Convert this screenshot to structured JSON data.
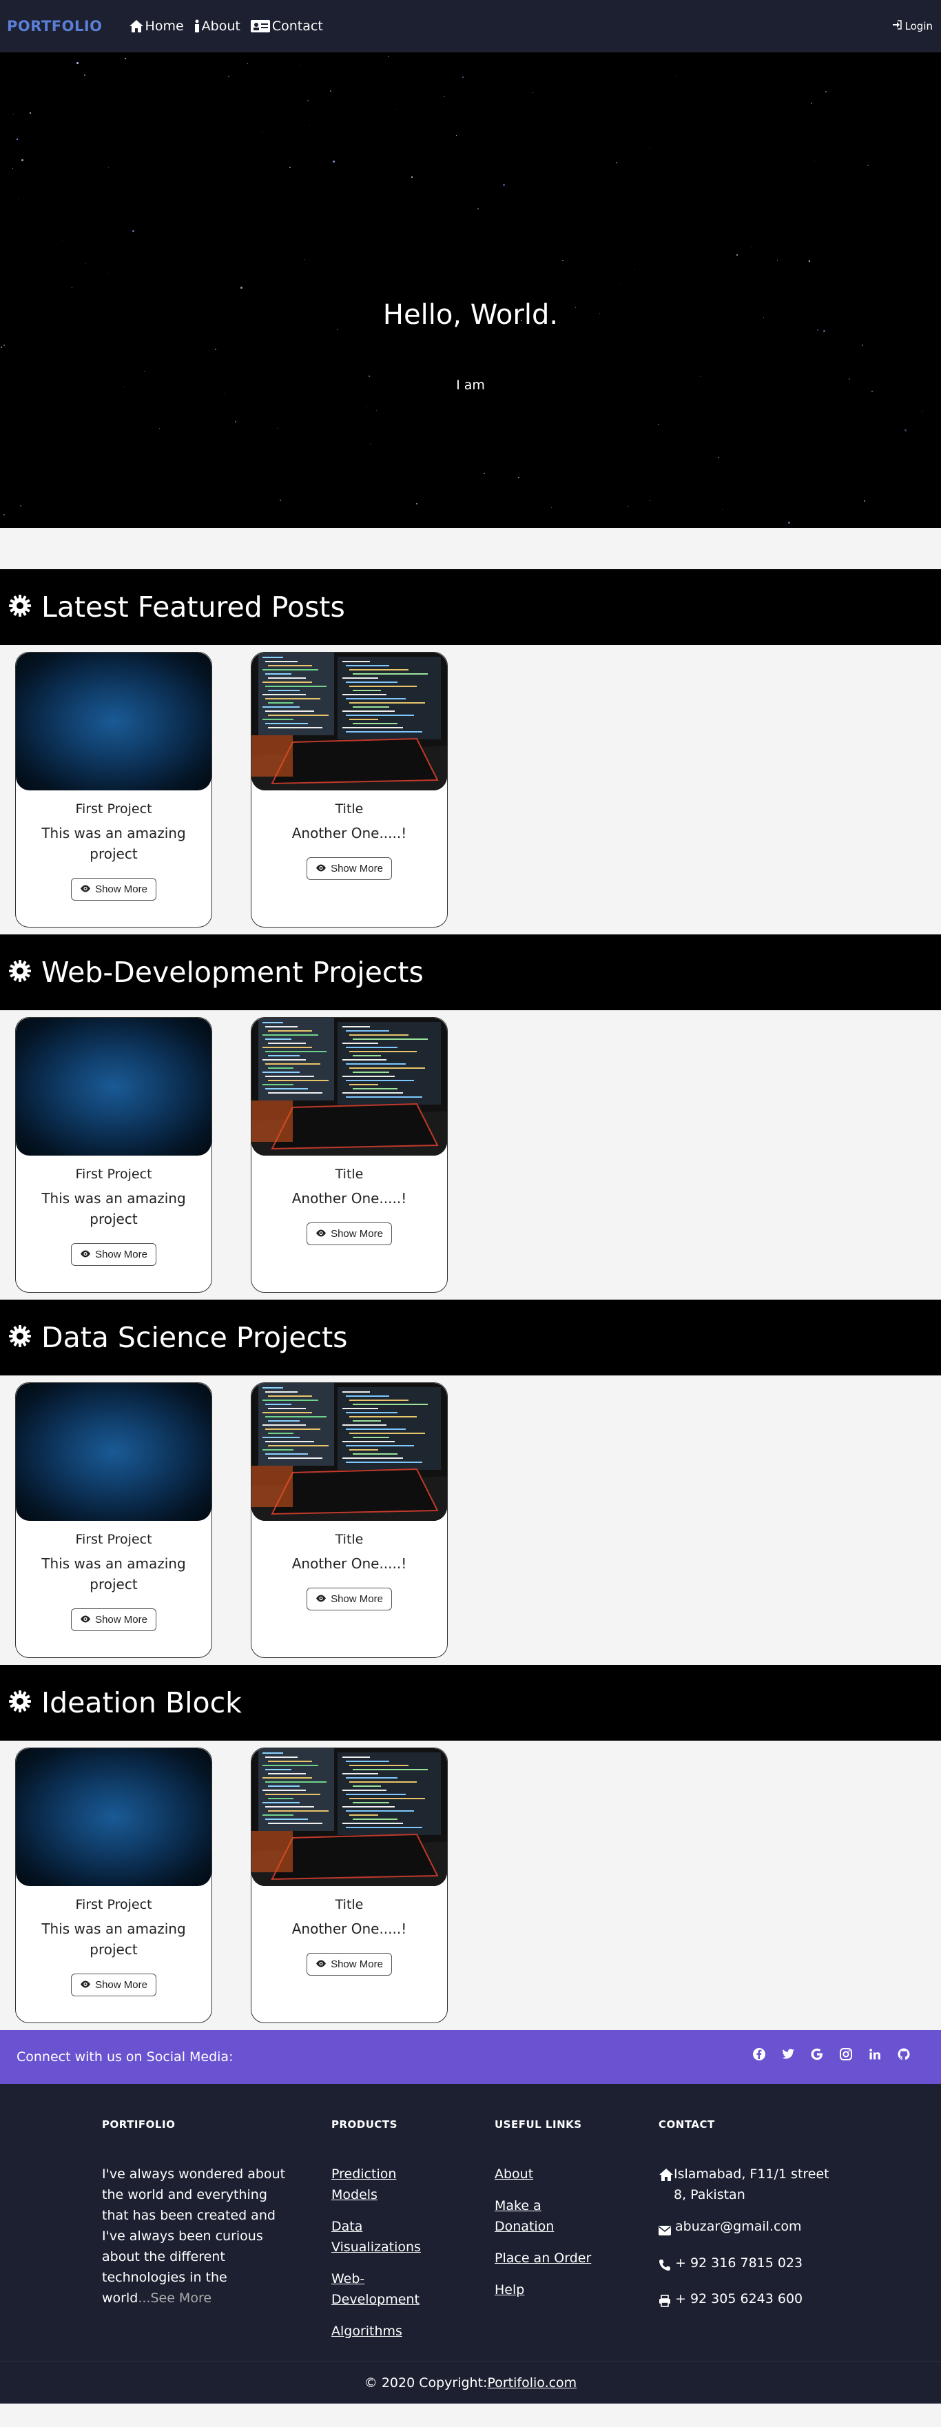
{
  "navbar": {
    "brand": "PORTFOLIO",
    "links": [
      {
        "label": "Home",
        "icon": "home-icon"
      },
      {
        "label": "About",
        "icon": "info-icon"
      },
      {
        "label": "Contact",
        "icon": "id-card-icon"
      }
    ],
    "login_label": "Login"
  },
  "hero": {
    "title": "Hello, World.",
    "subtitle": "I am"
  },
  "sections": [
    {
      "title": "Latest Featured Posts",
      "cards": [
        {
          "title": "First Project",
          "text": "This was an amazing project",
          "button": "Show More"
        },
        {
          "title": "Title",
          "text": "Another One.....!",
          "button": "Show More"
        }
      ]
    },
    {
      "title": "Web-Development Projects",
      "cards": [
        {
          "title": "First Project",
          "text": "This was an amazing project",
          "button": "Show More"
        },
        {
          "title": "Title",
          "text": "Another One.....!",
          "button": "Show More"
        }
      ]
    },
    {
      "title": "Data Science Projects",
      "cards": [
        {
          "title": "First Project",
          "text": "This was an amazing project",
          "button": "Show More"
        },
        {
          "title": "Title",
          "text": "Another One.....!",
          "button": "Show More"
        }
      ]
    },
    {
      "title": "Ideation Block",
      "cards": [
        {
          "title": "First Project",
          "text": "This was an amazing project",
          "button": "Show More"
        },
        {
          "title": "Title",
          "text": "Another One.....!",
          "button": "Show More"
        }
      ]
    }
  ],
  "social": {
    "text": "Connect with us on Social Media:",
    "icons": [
      "facebook-icon",
      "twitter-icon",
      "google-icon",
      "instagram-icon",
      "linkedin-icon",
      "github-icon"
    ]
  },
  "footer": {
    "about": {
      "heading": "PORTIFOLIO",
      "text": "I've always wondered about the world and everything that has been created and I've always been curious about the different technologies in the world",
      "see_more": "...See More"
    },
    "products": {
      "heading": "PRODUCTS",
      "links": [
        "Prediction Models",
        "Data Visualizations",
        "Web-Development",
        "Algorithms"
      ]
    },
    "useful_links": {
      "heading": "USEFUL LINKS",
      "links": [
        "About",
        "Make a Donation",
        "Place an Order",
        "Help"
      ]
    },
    "contact": {
      "heading": "CONTACT",
      "address": "Islamabad, F11/1 street 8, Pakistan",
      "email": "abuzar@gmail.com",
      "phone": "+ 92 316 7815 023",
      "fax": "+ 92 305 6243 600"
    }
  },
  "copyright": {
    "text": "© 2020 Copyright:",
    "link": " Portifolio.com"
  },
  "colors": {
    "navbar_bg": "#1c2030",
    "brand": "#5a7fd6",
    "social_bar": "#6a52d1",
    "section_header_bg": "#000000"
  }
}
